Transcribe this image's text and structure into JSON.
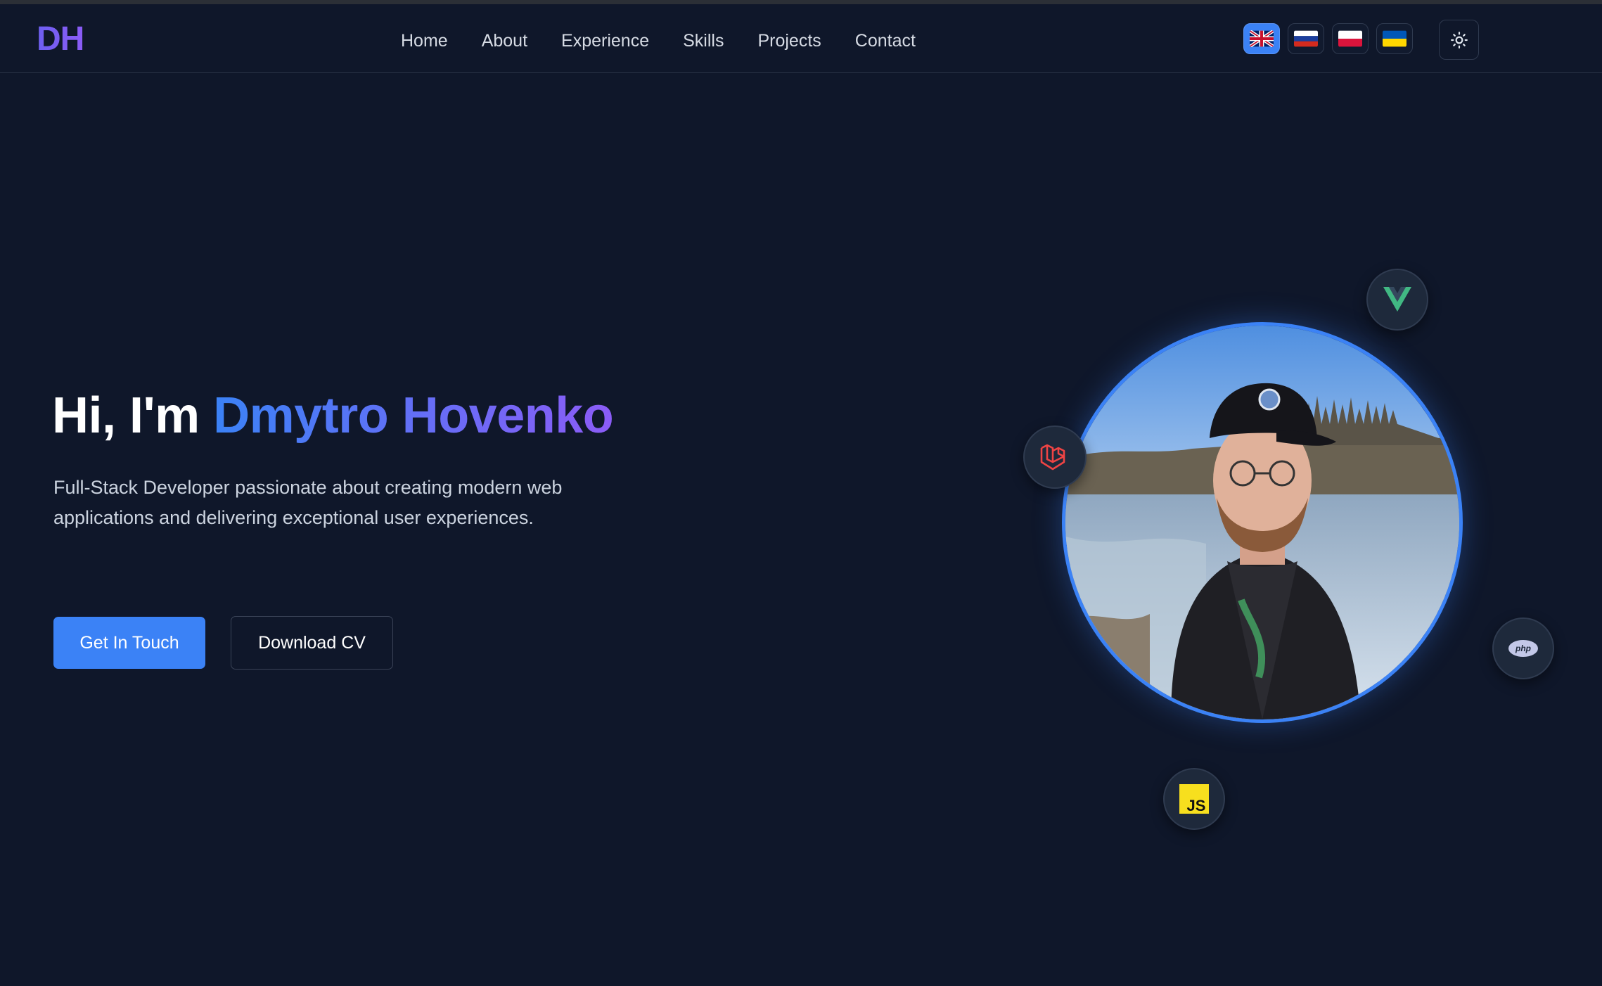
{
  "header": {
    "logo": "DH",
    "nav": [
      "Home",
      "About",
      "Experience",
      "Skills",
      "Projects",
      "Contact"
    ],
    "languages": [
      {
        "code": "en",
        "icon": "flag-uk-icon",
        "active": true
      },
      {
        "code": "ru",
        "icon": "flag-ru-icon",
        "active": false
      },
      {
        "code": "pl",
        "icon": "flag-pl-icon",
        "active": false
      },
      {
        "code": "ua",
        "icon": "flag-ua-icon",
        "active": false
      }
    ],
    "theme_toggle_icon": "sun-icon"
  },
  "hero": {
    "greeting": "Hi, I'm ",
    "name": "Dmytro Hovenko",
    "subtitle": "Full-Stack Developer passionate about creating modern web applications and delivering exceptional user experiences.",
    "primary_button": "Get In Touch",
    "secondary_button": "Download CV"
  },
  "tech_badges": [
    {
      "icon": "vue-icon"
    },
    {
      "icon": "laravel-icon"
    },
    {
      "icon": "php-icon",
      "label": "php"
    },
    {
      "icon": "javascript-icon",
      "label": "JS"
    }
  ],
  "colors": {
    "background": "#0f172a",
    "accent": "#3b82f6",
    "accent_gradient_end": "#8b5cf6",
    "badge_bg": "#1e293b"
  }
}
